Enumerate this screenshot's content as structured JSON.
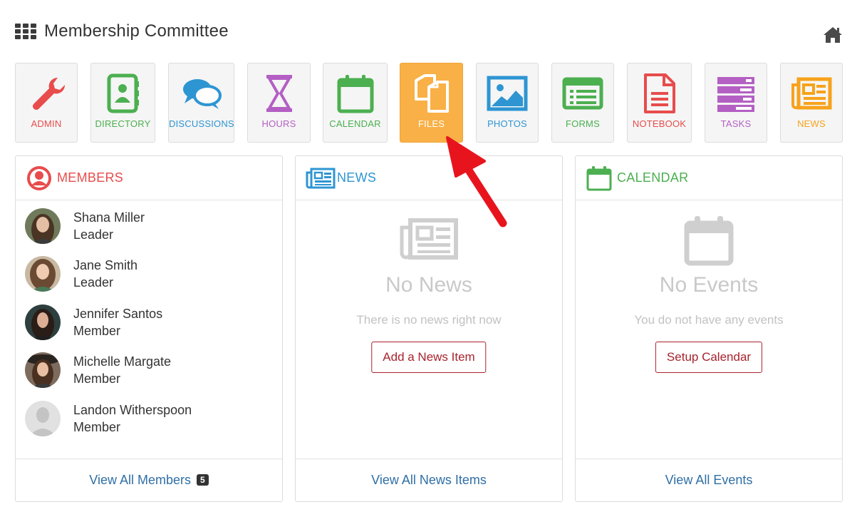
{
  "header": {
    "title": "Membership Committee",
    "grid_icon": "grid-icon",
    "home_icon": "home-icon"
  },
  "apps": [
    {
      "label": "ADMIN",
      "icon": "wrench-icon",
      "color": "#e84c4c"
    },
    {
      "label": "DIRECTORY",
      "icon": "address-book-icon",
      "color": "#4caf50"
    },
    {
      "label": "DISCUSSIONS",
      "icon": "chat-bubbles-icon",
      "color": "#2e95d3"
    },
    {
      "label": "HOURS",
      "icon": "hourglass-icon",
      "color": "#b45fc4"
    },
    {
      "label": "CALENDAR",
      "icon": "calendar-icon",
      "color": "#4caf50"
    },
    {
      "label": "FILES",
      "icon": "files-icon",
      "color": "#ffffff",
      "active": true
    },
    {
      "label": "PHOTOS",
      "icon": "image-icon",
      "color": "#2e95d3"
    },
    {
      "label": "FORMS",
      "icon": "list-form-icon",
      "color": "#4caf50"
    },
    {
      "label": "NOTEBOOK",
      "icon": "document-icon",
      "color": "#e84c4c"
    },
    {
      "label": "TASKS",
      "icon": "task-bars-icon",
      "color": "#b45fc4"
    },
    {
      "label": "NEWS",
      "icon": "newspaper-icon",
      "color": "#f7a21b"
    }
  ],
  "members_panel": {
    "title": "MEMBERS",
    "color": "#e84c4c",
    "members": [
      {
        "name": "Shana Miller",
        "role": "Leader"
      },
      {
        "name": "Jane Smith",
        "role": "Leader"
      },
      {
        "name": "Jennifer Santos",
        "role": "Member"
      },
      {
        "name": "Michelle Margate",
        "role": "Member"
      },
      {
        "name": "Landon Witherspoon",
        "role": "Member"
      }
    ],
    "footer_link": "View All Members",
    "count": "5"
  },
  "news_panel": {
    "title": "NEWS",
    "color": "#2e95d3",
    "empty_title": "No News",
    "empty_sub": "There is no news right now",
    "button": "Add a News Item",
    "footer_link": "View All News Items"
  },
  "calendar_panel": {
    "title": "CALENDAR",
    "color": "#4caf50",
    "empty_title": "No Events",
    "empty_sub": "You do not have any events",
    "button": "Setup Calendar",
    "footer_link": "View All Events"
  },
  "colors": {
    "link": "#2f6fa5",
    "button_outline": "#a8232d",
    "active_tile": "#f9b046",
    "arrow": "#e8141d"
  }
}
